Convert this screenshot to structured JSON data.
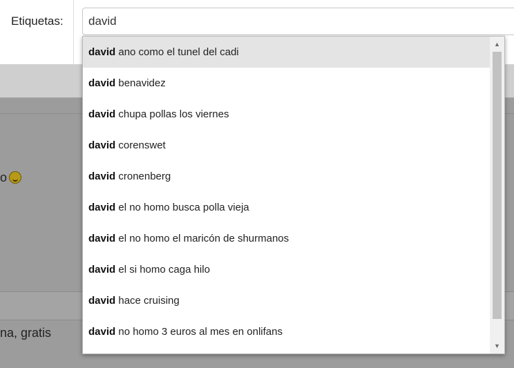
{
  "tag_field": {
    "label": "Etiquetas:",
    "value": "david"
  },
  "background": {
    "snippet_1": "o",
    "snippet_2": "na, gratis"
  },
  "suggestions": {
    "query": "david",
    "items": [
      {
        "bold": "david",
        "rest": " ano como el tunel del cadi"
      },
      {
        "bold": "david",
        "rest": " benavidez"
      },
      {
        "bold": "david",
        "rest": " chupa pollas los viernes"
      },
      {
        "bold": "david",
        "rest": " corenswet"
      },
      {
        "bold": "david",
        "rest": " cronenberg"
      },
      {
        "bold": "david",
        "rest": " el no homo busca polla vieja"
      },
      {
        "bold": "david",
        "rest": " el no homo el maricón de shurmanos"
      },
      {
        "bold": "david",
        "rest": " el si homo caga hilo"
      },
      {
        "bold": "david",
        "rest": " hace cruising"
      },
      {
        "bold": "david",
        "rest": " no homo 3 euros al mes en onlifans"
      }
    ],
    "scroll_fraction_visible": 0.85,
    "scroll_position": 0
  },
  "icons": {
    "scroll_up": "▲",
    "scroll_down": "▼",
    "emoji": "grinning-emoji"
  },
  "colors": {
    "highlight": "#e4e4e4",
    "overlay": "#9c9c9c"
  }
}
